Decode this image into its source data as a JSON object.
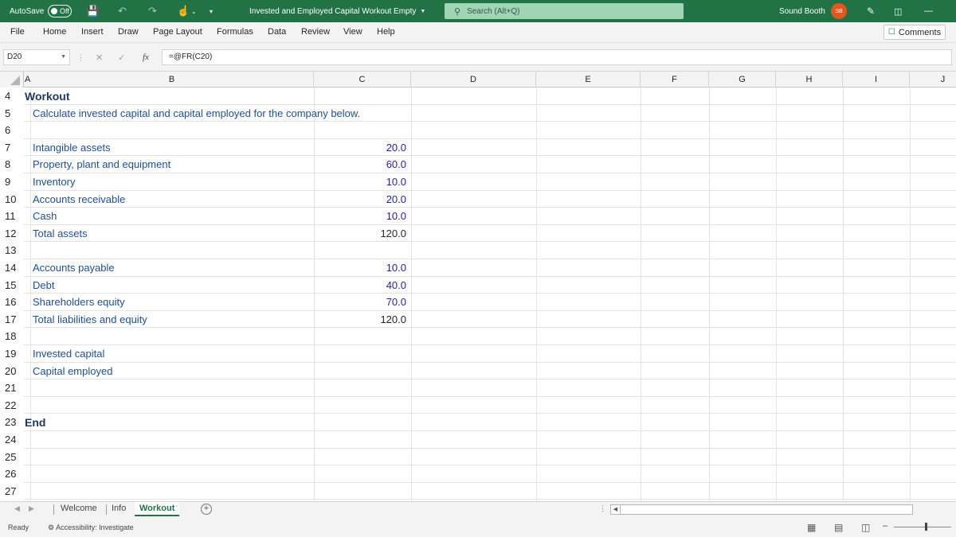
{
  "titlebar": {
    "autosave_label": "AutoSave",
    "autosave_state": "Off",
    "doc_title": "Invested and Employed Capital Workout Empty",
    "search_placeholder": "Search (Alt+Q)",
    "user_name": "Sound Booth",
    "user_initials": "SB"
  },
  "menu": {
    "items": [
      "File",
      "Home",
      "Insert",
      "Draw",
      "Page Layout",
      "Formulas",
      "Data",
      "Review",
      "View",
      "Help"
    ],
    "comments_label": "Comments"
  },
  "formulabar": {
    "name_box": "D20",
    "fx_label": "fx",
    "formula": "=@FR(C20)"
  },
  "grid": {
    "columns": [
      "A",
      "B",
      "C",
      "D",
      "E",
      "F",
      "G",
      "H",
      "I",
      "J"
    ],
    "rows": [
      {
        "num": "4",
        "a": "Workout",
        "b": "",
        "c": "",
        "c_type": ""
      },
      {
        "num": "5",
        "a": "",
        "b": "Calculate invested capital and capital employed for the company below.",
        "c": "",
        "c_type": ""
      },
      {
        "num": "6",
        "a": "",
        "b": "",
        "c": "",
        "c_type": ""
      },
      {
        "num": "7",
        "a": "",
        "b": "Intangible assets",
        "c": "20.0",
        "c_type": "input"
      },
      {
        "num": "8",
        "a": "",
        "b": "Property, plant and equipment",
        "c": "60.0",
        "c_type": "input"
      },
      {
        "num": "9",
        "a": "",
        "b": "Inventory",
        "c": "10.0",
        "c_type": "input"
      },
      {
        "num": "10",
        "a": "",
        "b": "Accounts receivable",
        "c": "20.0",
        "c_type": "input"
      },
      {
        "num": "11",
        "a": "",
        "b": "Cash",
        "c": "10.0",
        "c_type": "input"
      },
      {
        "num": "12",
        "a": "",
        "b": "Total assets",
        "c": "120.0",
        "c_type": "calc"
      },
      {
        "num": "13",
        "a": "",
        "b": "",
        "c": "",
        "c_type": ""
      },
      {
        "num": "14",
        "a": "",
        "b": "Accounts payable",
        "c": "10.0",
        "c_type": "input"
      },
      {
        "num": "15",
        "a": "",
        "b": "Debt",
        "c": "40.0",
        "c_type": "input"
      },
      {
        "num": "16",
        "a": "",
        "b": "Shareholders equity",
        "c": "70.0",
        "c_type": "input"
      },
      {
        "num": "17",
        "a": "",
        "b": "Total liabilities and equity",
        "c": "120.0",
        "c_type": "calc"
      },
      {
        "num": "18",
        "a": "",
        "b": "",
        "c": "",
        "c_type": ""
      },
      {
        "num": "19",
        "a": "",
        "b": "Invested capital",
        "c": "",
        "c_type": ""
      },
      {
        "num": "20",
        "a": "",
        "b": "Capital employed",
        "c": "",
        "c_type": ""
      },
      {
        "num": "21",
        "a": "",
        "b": "",
        "c": "",
        "c_type": ""
      },
      {
        "num": "22",
        "a": "",
        "b": "",
        "c": "",
        "c_type": ""
      },
      {
        "num": "23",
        "a": "End",
        "b": "",
        "c": "",
        "c_type": ""
      },
      {
        "num": "24",
        "a": "",
        "b": "",
        "c": "",
        "c_type": ""
      },
      {
        "num": "25",
        "a": "",
        "b": "",
        "c": "",
        "c_type": ""
      },
      {
        "num": "26",
        "a": "",
        "b": "",
        "c": "",
        "c_type": ""
      },
      {
        "num": "27",
        "a": "",
        "b": "",
        "c": "",
        "c_type": ""
      }
    ]
  },
  "sheets": {
    "tabs": [
      "Welcome",
      "Info",
      "Workout"
    ],
    "active": "Workout"
  },
  "status": {
    "ready": "Ready",
    "accessibility": "Accessibility: Investigate"
  },
  "colors": {
    "excel_green": "#217346",
    "label_blue": "#1f4e9c",
    "input_blue": "#1f1fb4",
    "heading_navy": "#1f3864",
    "avatar_orange": "#e5561f"
  }
}
